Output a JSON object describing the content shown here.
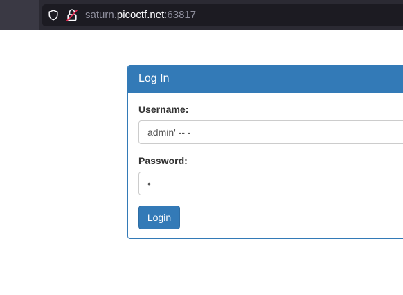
{
  "browser": {
    "url_host_prefix": "saturn.",
    "url_host_domain": "picoctf.net",
    "url_port": ":63817",
    "icons": {
      "shield": "shield-icon",
      "lock": "insecure-lock-icon"
    }
  },
  "login_panel": {
    "title": "Log In",
    "username_label": "Username:",
    "username_value": "admin' -- -",
    "password_label": "Password:",
    "password_value": "a",
    "submit_label": "Login"
  },
  "colors": {
    "accent": "#337ab7",
    "toolbar_bg": "#2b2a33",
    "insecure_lock": "#e22850"
  }
}
